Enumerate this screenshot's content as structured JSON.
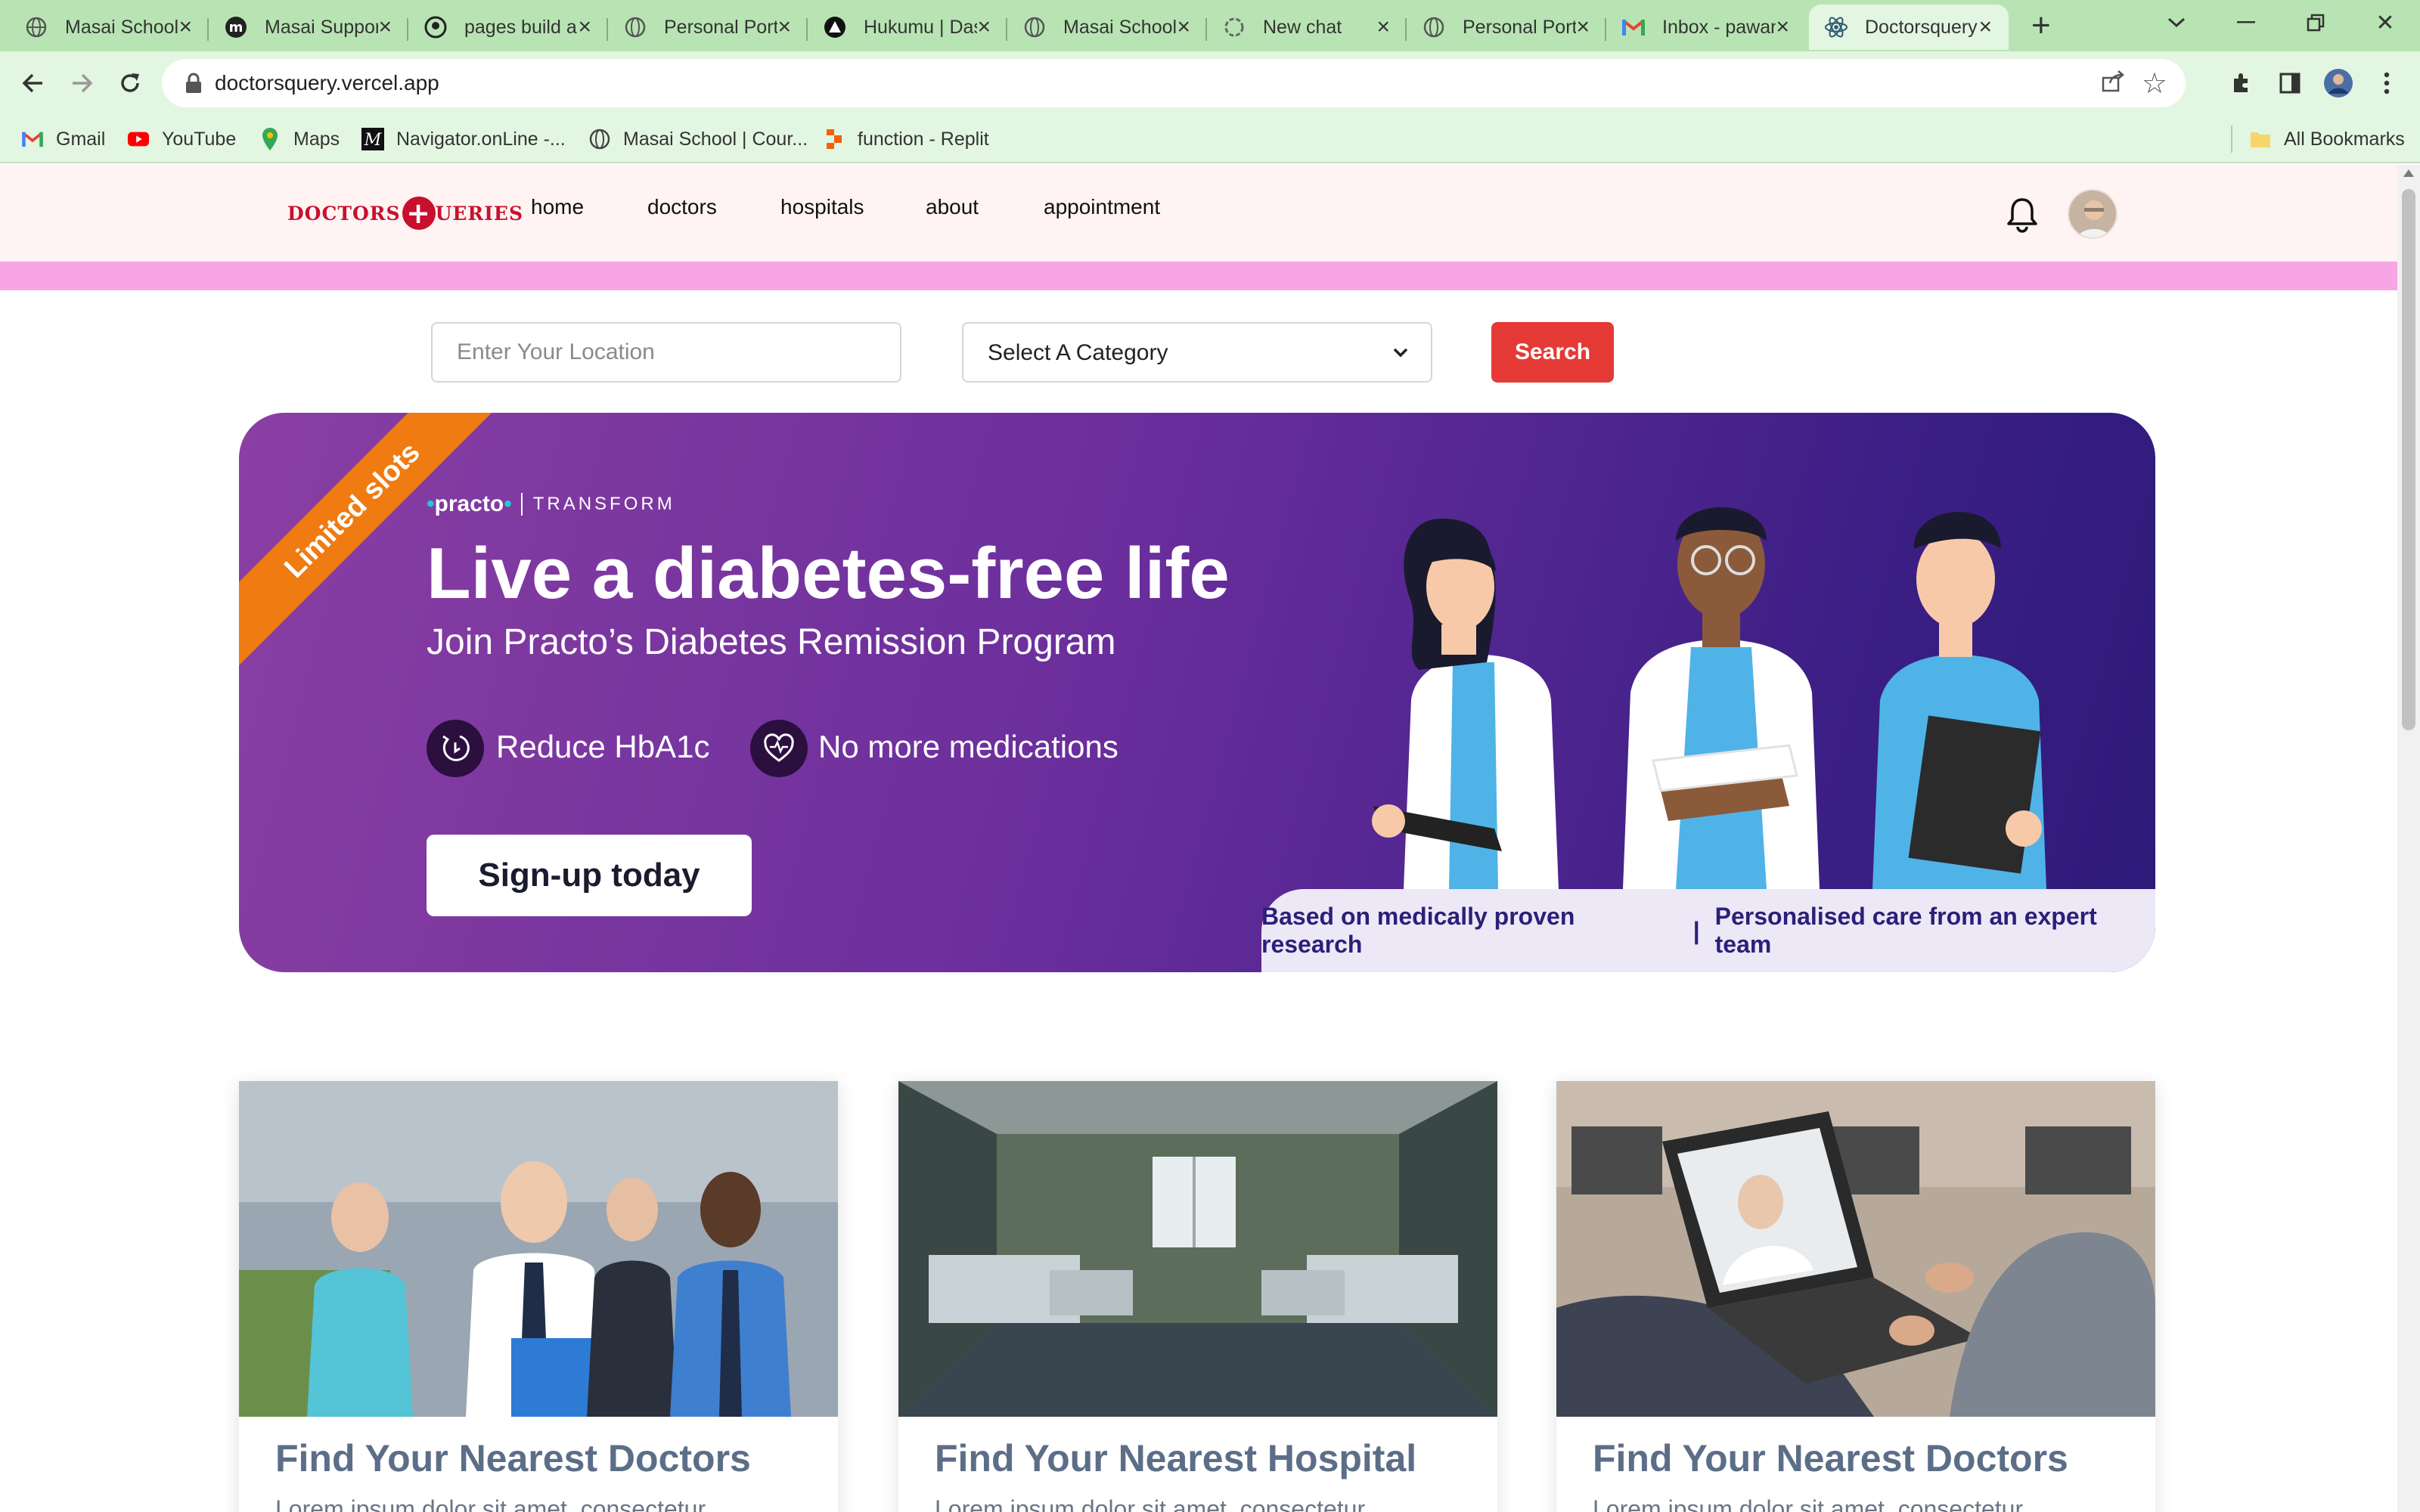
{
  "browser": {
    "tabs": [
      {
        "title": "Masai School",
        "icon": "globe-icon"
      },
      {
        "title": "Masai Support",
        "icon": "masai-m-icon"
      },
      {
        "title": "pages build and deployment",
        "icon": "github-icon"
      },
      {
        "title": "Personal Portfolio",
        "icon": "globe-icon"
      },
      {
        "title": "Hukumu | Dashboard",
        "icon": "hukumu-icon"
      },
      {
        "title": "Masai School",
        "icon": "globe-icon"
      },
      {
        "title": "New chat",
        "icon": "openai-icon"
      },
      {
        "title": "Personal Portfolio",
        "icon": "globe-icon"
      },
      {
        "title": "Inbox - pawan",
        "icon": "gmail-icon"
      },
      {
        "title": "Doctorsquery",
        "icon": "react-icon",
        "active": true
      }
    ],
    "url": "doctorsquery.vercel.app",
    "bookmarks": [
      {
        "label": "Gmail",
        "icon": "gmail-icon"
      },
      {
        "label": "YouTube",
        "icon": "youtube-icon"
      },
      {
        "label": "Maps",
        "icon": "maps-icon"
      },
      {
        "label": "Navigator.onLine -...",
        "icon": "navigator-icon"
      },
      {
        "label": "Masai School | Cour...",
        "icon": "globe-icon"
      },
      {
        "label": "function - Replit",
        "icon": "replit-icon"
      }
    ],
    "all_bookmarks": "All Bookmarks"
  },
  "site": {
    "logo": {
      "left": "DOCTORS",
      "right": "UERIES",
      "mark": "+"
    },
    "nav": [
      "home",
      "doctors",
      "hospitals",
      "about",
      "appointment"
    ]
  },
  "search": {
    "location_placeholder": "Enter Your Location",
    "category_value": "Select A Category",
    "button": "Search"
  },
  "banner": {
    "ribbon": "Limited slots",
    "brand": "practo",
    "brand_sub": "TRANSFORM",
    "headline": "Live a diabetes-free life",
    "subhead": "Join Practo’s Diabetes Remission Program",
    "features": [
      "Reduce HbA1c",
      "No more medications"
    ],
    "cta": "Sign-up today",
    "footer_left": "Based on medically proven research",
    "footer_sep": "|",
    "footer_right": "Personalised care from an expert team"
  },
  "cards": [
    {
      "title": "Find Your Nearest Doctors",
      "text": "Lorem ipsum dolor sit amet, consectetur"
    },
    {
      "title": "Find Your Nearest Hospital",
      "text": "Lorem ipsum dolor sit amet, consectetur"
    },
    {
      "title": "Find Your Nearest Doctors",
      "text": "Lorem ipsum dolor sit amet, consectetur"
    }
  ],
  "colors": {
    "chrome": "#b8e4b3",
    "toolbar": "#e3f6e1",
    "accent_red": "#e53935",
    "banner_purple": "#6a2e9c",
    "ribbon_orange": "#ef7b11",
    "pink_band": "#f8a5e4",
    "card_title": "#5c6e87"
  }
}
